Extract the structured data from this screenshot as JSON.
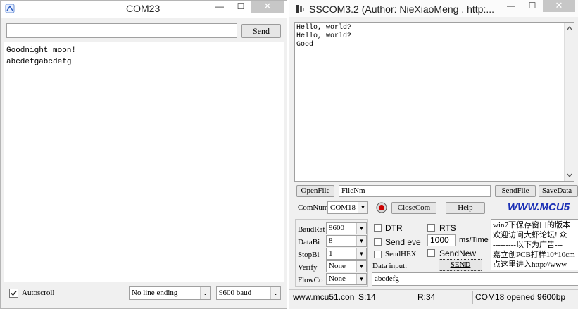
{
  "serial_monitor": {
    "title": "COM23",
    "window_controls": {
      "minimize": "—",
      "maximize": "☐",
      "close": "✕"
    },
    "send_input_value": "",
    "send_button": "Send",
    "output_lines": [
      "Goodnight moon!",
      "abcdefgabcdefg"
    ],
    "autoscroll_label": "Autoscroll",
    "autoscroll_checked": true,
    "line_ending_selected": "No line ending",
    "baud_selected": "9600 baud"
  },
  "sscom": {
    "title": "SSCOM3.2 (Author: NieXiaoMeng .  http:...",
    "window_controls": {
      "minimize": "—",
      "maximize": "☐",
      "close": "✕"
    },
    "receive_lines": [
      "Hello, world?",
      "Hello, world?",
      "Good"
    ],
    "open_file_button": "OpenFile",
    "file_name_value": "FileNm",
    "send_file_button": "SendFile",
    "save_data_button": "SaveData",
    "com_num_label": "ComNum",
    "com_num_selected": "COM18",
    "close_com_button": "CloseCom",
    "help_button": "Help",
    "brand_text": "WWW.MCU5",
    "baud_rate_label": "BaudRat",
    "baud_rate_selected": "9600",
    "data_bits_label": "DataBi",
    "data_bits_selected": "8",
    "stop_bits_label": "StopBi",
    "stop_bits_selected": "1",
    "verify_label": "Verify",
    "verify_selected": "None",
    "flow_control_label": "FlowCo",
    "flow_control_selected": "None",
    "dtr_label": "DTR",
    "rts_label": "RTS",
    "send_every_label": "Send eve",
    "send_every_value": "1000",
    "send_every_unit": "ms/Time",
    "send_hex_label": "SendHEX",
    "send_new_label": "SendNew",
    "data_input_label": "Data input:",
    "send_button": "SEND",
    "data_input_value": "abcdefg",
    "ad_lines": [
      "win7下保存窗口的版本",
      "欢迎访问大虾论坛! 众",
      "---------以下为广告---",
      "嘉立创PCB打样10*10cm",
      "点这里进入http://www"
    ],
    "status_site": "www.mcu51.con",
    "status_sent": "S:14",
    "status_received": "R:34",
    "status_port": "COM18 opened 9600bp",
    "colors": {
      "brand_blue": "#1a2fb5",
      "brand_red": "#d11a1a",
      "record_red": "#cc0000"
    }
  }
}
